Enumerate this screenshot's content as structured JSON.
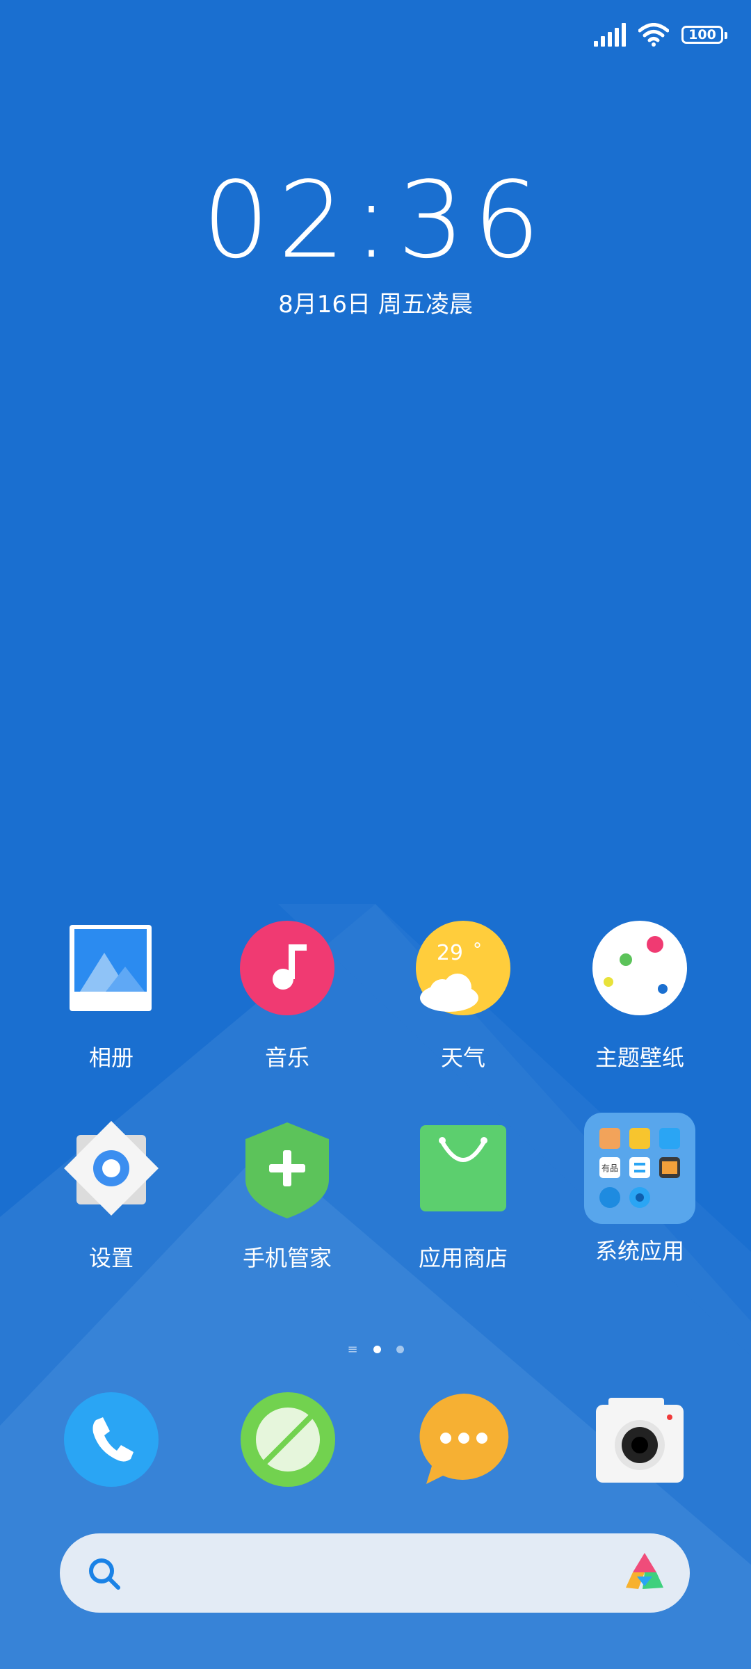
{
  "status_bar": {
    "battery": "100"
  },
  "lock": {
    "time": "02:36",
    "date": "8月16日 周五凌晨"
  },
  "apps": [
    {
      "label": "相册",
      "icon": "gallery-icon"
    },
    {
      "label": "音乐",
      "icon": "music-icon"
    },
    {
      "label": "天气",
      "icon": "weather-icon",
      "temperature": "29",
      "unit": "°"
    },
    {
      "label": "主题壁纸",
      "icon": "themes-icon"
    },
    {
      "label": "设置",
      "icon": "settings-icon"
    },
    {
      "label": "手机管家",
      "icon": "security-icon"
    },
    {
      "label": "应用商店",
      "icon": "app-store-icon"
    },
    {
      "label": "系统应用",
      "icon": "folder-icon",
      "folder_text": "有品"
    }
  ],
  "page_indicator": {
    "pages": 2,
    "active": 0
  },
  "dock": [
    "phone-icon",
    "browser-icon",
    "messages-icon",
    "camera-icon"
  ],
  "search": {
    "icon": "search-icon",
    "assistant": "assistant-logo-icon"
  },
  "colors": {
    "background": "#1a6fd0",
    "music": "#f03a72",
    "weather": "#ffcd3c",
    "security": "#5cc35a",
    "store": "#5ccf6e",
    "phone": "#2aa5f4",
    "browser": "#72d24f",
    "messages": "#f6b033"
  }
}
